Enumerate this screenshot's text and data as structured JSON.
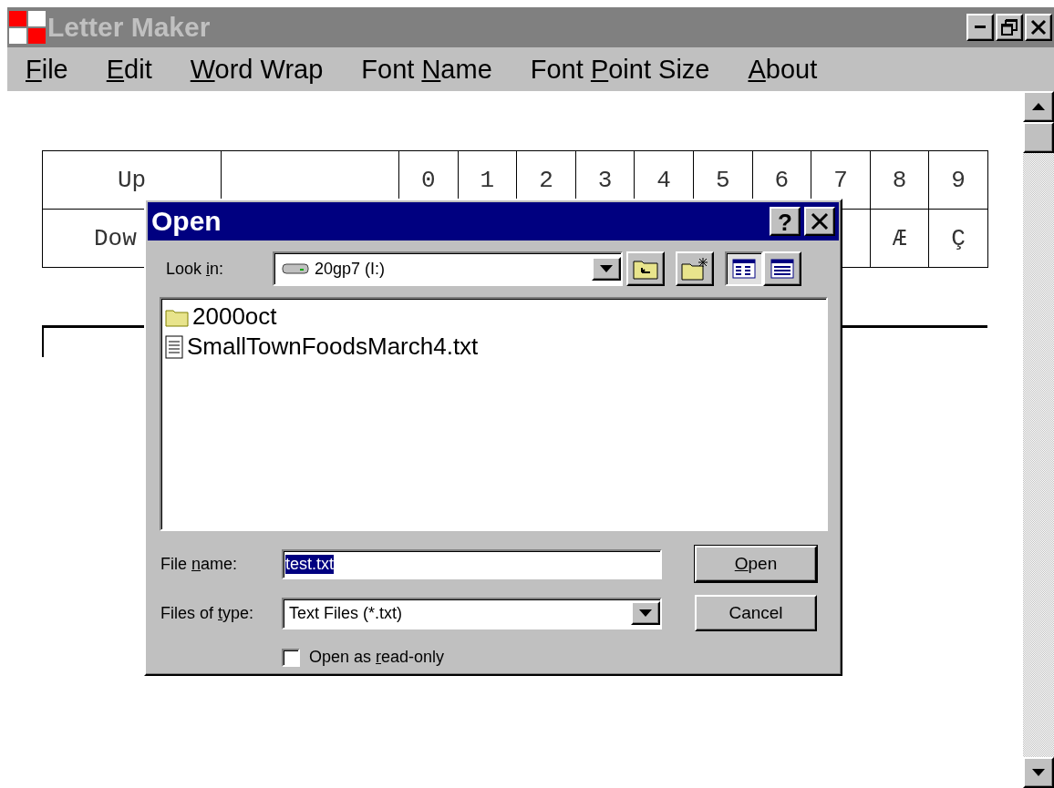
{
  "window": {
    "title": "Letter Maker"
  },
  "menu": [
    {
      "key": "F",
      "post": "ile"
    },
    {
      "key": "E",
      "post": "dit"
    },
    {
      "key": "W",
      "post": "ord Wrap"
    },
    {
      "pre": "Font ",
      "key": "N",
      "post": "ame"
    },
    {
      "pre": "Font ",
      "key": "P",
      "post": "oint Size"
    },
    {
      "key": "A",
      "post": "bout"
    }
  ],
  "grid": {
    "rows": [
      {
        "cells": [
          "Up",
          null,
          "0",
          "1",
          "2",
          "3",
          "4",
          "5",
          "6",
          "7",
          "8",
          "9"
        ]
      },
      {
        "cells": [
          "Dow"
        ],
        "end_cells": [
          null,
          "Æ",
          "Ç"
        ]
      }
    ]
  },
  "dialog": {
    "title": "Open",
    "help": "?",
    "look_in": {
      "label": {
        "pre": "Look ",
        "key": "i",
        "post": "n:"
      },
      "value": "20gp7 (I:)"
    },
    "views": [
      {
        "kind": "list",
        "selected": true
      },
      {
        "kind": "details",
        "selected": false
      }
    ],
    "files": [
      {
        "kind": "folder",
        "name": "2000oct"
      },
      {
        "kind": "text",
        "name": "SmallTownFoodsMarch4.txt"
      }
    ],
    "file_name": {
      "label": {
        "pre": "File ",
        "key": "n",
        "post": "ame:"
      },
      "value": "test.txt",
      "selected": true
    },
    "file_type": {
      "label": {
        "pre": "Files of ",
        "key": "t",
        "post": "ype:"
      },
      "value": "Text Files (*.txt)"
    },
    "read_only": {
      "label": {
        "pre": "Open as ",
        "key": "r",
        "post": "ead-only"
      },
      "checked": false
    },
    "buttons": [
      {
        "label": {
          "key": "O",
          "post": "pen"
        },
        "default": true
      },
      {
        "label": {
          "pre": "Cancel"
        },
        "default": false
      }
    ]
  }
}
